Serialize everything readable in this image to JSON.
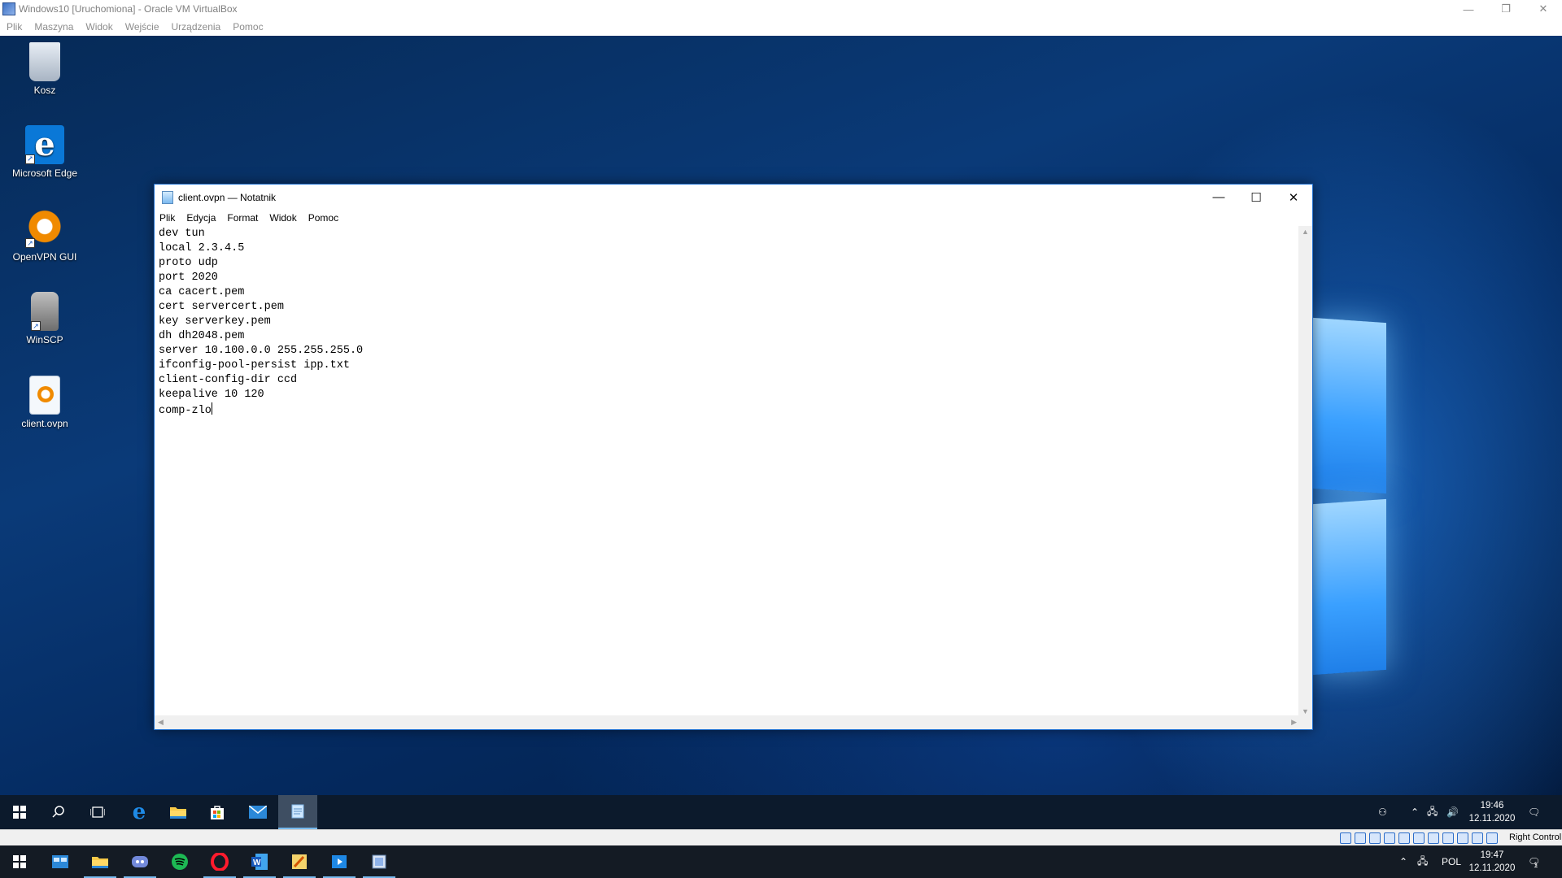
{
  "host_window": {
    "title": "Windows10 [Uruchomiona] - Oracle VM VirtualBox",
    "menu": [
      "Plik",
      "Maszyna",
      "Widok",
      "Wejście",
      "Urządzenia",
      "Pomoc"
    ],
    "controls": {
      "minimize": "—",
      "restore": "❐",
      "close": "✕"
    }
  },
  "desktop": {
    "icons": [
      {
        "label": "Kosz",
        "icon": "recycle-bin-icon"
      },
      {
        "label": "Microsoft Edge",
        "icon": "edge-icon"
      },
      {
        "label": "OpenVPN GUI",
        "icon": "openvpn-icon"
      },
      {
        "label": "WinSCP",
        "icon": "winscp-icon"
      },
      {
        "label": "client.ovpn",
        "icon": "ovpn-file-icon"
      }
    ]
  },
  "notepad": {
    "title": "client.ovpn — Notatnik",
    "menu": [
      "Plik",
      "Edycja",
      "Format",
      "Widok",
      "Pomoc"
    ],
    "controls": {
      "minimize": "—",
      "maximize": "☐",
      "close": "✕"
    },
    "lines": [
      "dev tun",
      "local 2.3.4.5",
      "proto udp",
      "port 2020",
      "ca cacert.pem",
      "cert servercert.pem",
      "key serverkey.pem",
      "dh dh2048.pem",
      "server 10.100.0.0 255.255.255.0",
      "ifconfig-pool-persist ipp.txt",
      "client-config-dir ccd",
      "keepalive 10 120",
      "comp-zlo"
    ]
  },
  "guest_taskbar": {
    "pinned": [
      "start-icon",
      "search-icon",
      "task-view-icon",
      "edge-icon",
      "file-explorer-icon",
      "store-icon",
      "mail-icon",
      "notepad-icon"
    ],
    "active": "notepad-icon",
    "time": "19:46",
    "date": "12.11.2020"
  },
  "vbox_status": {
    "host_key": "Right Control"
  },
  "host_taskbar": {
    "pinned": [
      "start-icon",
      "explorer-icon",
      "file-explorer-icon",
      "discord-icon",
      "spotify-icon",
      "opera-icon",
      "word-icon",
      "paint-icon",
      "media-player-icon",
      "virtualbox-icon"
    ],
    "language": "POL",
    "time": "19:47",
    "date": "12.11.2020",
    "notification_count": "1"
  },
  "colors": {
    "accent": "#1e6fd0",
    "taskbar": "#0c1a2c",
    "host_taskbar": "#141b24"
  }
}
